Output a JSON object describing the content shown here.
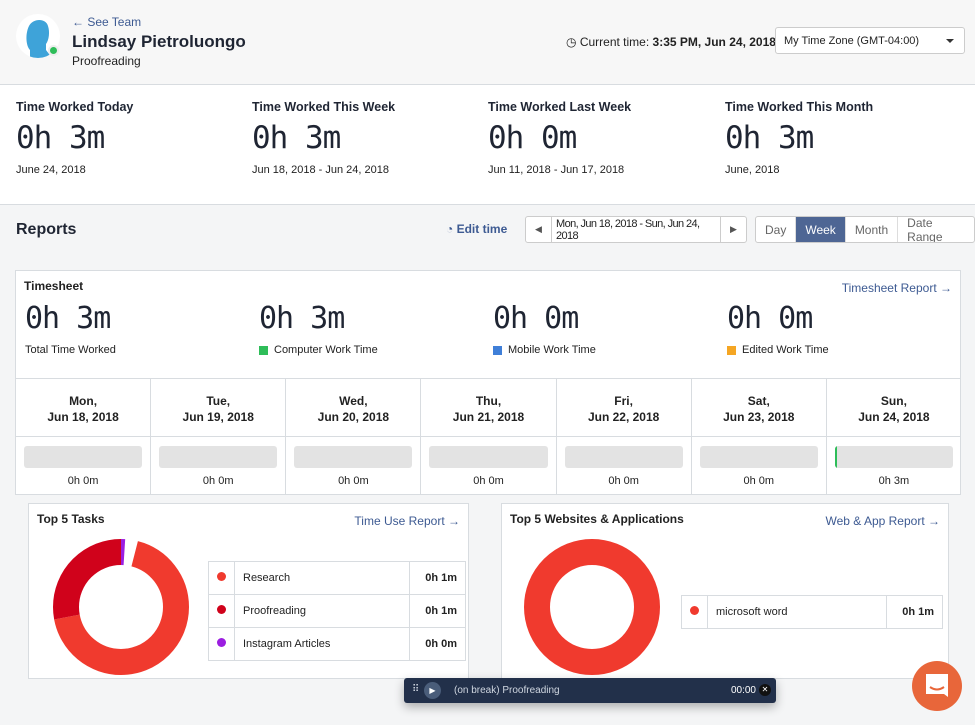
{
  "header": {
    "see_team": "← See Team",
    "name": "Lindsay Pietroluongo",
    "role": "Proofreading",
    "current_time_label": "Current time:",
    "current_time": "3:35 PM, Jun 24, 2018",
    "timezone": "My Time Zone (GMT-04:00)",
    "status_color": "#2ebd59"
  },
  "stats": [
    {
      "label": "Time Worked Today",
      "value": "0h 3m",
      "date": "June 24, 2018"
    },
    {
      "label": "Time Worked This Week",
      "value": "0h 3m",
      "date": "Jun 18, 2018 - Jun 24, 2018"
    },
    {
      "label": "Time Worked Last Week",
      "value": "0h 0m",
      "date": "Jun 11, 2018 - Jun 17, 2018"
    },
    {
      "label": "Time Worked This Month",
      "value": "0h 3m",
      "date": "June, 2018"
    }
  ],
  "reports": {
    "title": "Reports",
    "edit_time": "Edit time",
    "range": "Mon, Jun 18, 2018 - Sun, Jun 24, 2018",
    "views": [
      "Day",
      "Week",
      "Month",
      "Date Range"
    ],
    "active_view": "Week"
  },
  "timesheet": {
    "title": "Timesheet",
    "report_link": "Timesheet Report →",
    "totals": [
      {
        "value": "0h 3m",
        "label": "Total Time Worked",
        "color": ""
      },
      {
        "value": "0h 3m",
        "label": "Computer Work Time",
        "color": "#2ebd59"
      },
      {
        "value": "0h 0m",
        "label": "Mobile Work Time",
        "color": "#3f7fd8"
      },
      {
        "value": "0h 0m",
        "label": "Edited Work Time",
        "color": "#f5a623"
      }
    ],
    "days": [
      {
        "day": "Mon,",
        "date": "Jun 18, 2018",
        "time": "0h 0m",
        "fill": 0
      },
      {
        "day": "Tue,",
        "date": "Jun 19, 2018",
        "time": "0h 0m",
        "fill": 0
      },
      {
        "day": "Wed,",
        "date": "Jun 20, 2018",
        "time": "0h 0m",
        "fill": 0
      },
      {
        "day": "Thu,",
        "date": "Jun 21, 2018",
        "time": "0h 0m",
        "fill": 0
      },
      {
        "day": "Fri,",
        "date": "Jun 22, 2018",
        "time": "0h 0m",
        "fill": 0
      },
      {
        "day": "Sat,",
        "date": "Jun 23, 2018",
        "time": "0h 0m",
        "fill": 0
      },
      {
        "day": "Sun,",
        "date": "Jun 24, 2018",
        "time": "0h 3m",
        "fill": 0.02
      }
    ]
  },
  "tasks": {
    "title": "Top 5 Tasks",
    "link": "Time Use Report →",
    "items": [
      {
        "name": "Research",
        "time": "0h 1m",
        "color": "#f03a2e",
        "share": 0.68
      },
      {
        "name": "Proofreading",
        "time": "0h 1m",
        "color": "#d0021b",
        "share": 0.29
      },
      {
        "name": "Instagram Articles",
        "time": "0h 0m",
        "color": "#9b1ee0",
        "share": 0.03
      }
    ]
  },
  "apps": {
    "title": "Top 5 Websites & Applications",
    "link": "Web & App Report →",
    "items": [
      {
        "name": "microsoft word",
        "time": "0h 1m",
        "color": "#f03a2e",
        "share": 1
      }
    ]
  },
  "timer": {
    "label": "(on break) Proofreading",
    "time": "00:00"
  }
}
